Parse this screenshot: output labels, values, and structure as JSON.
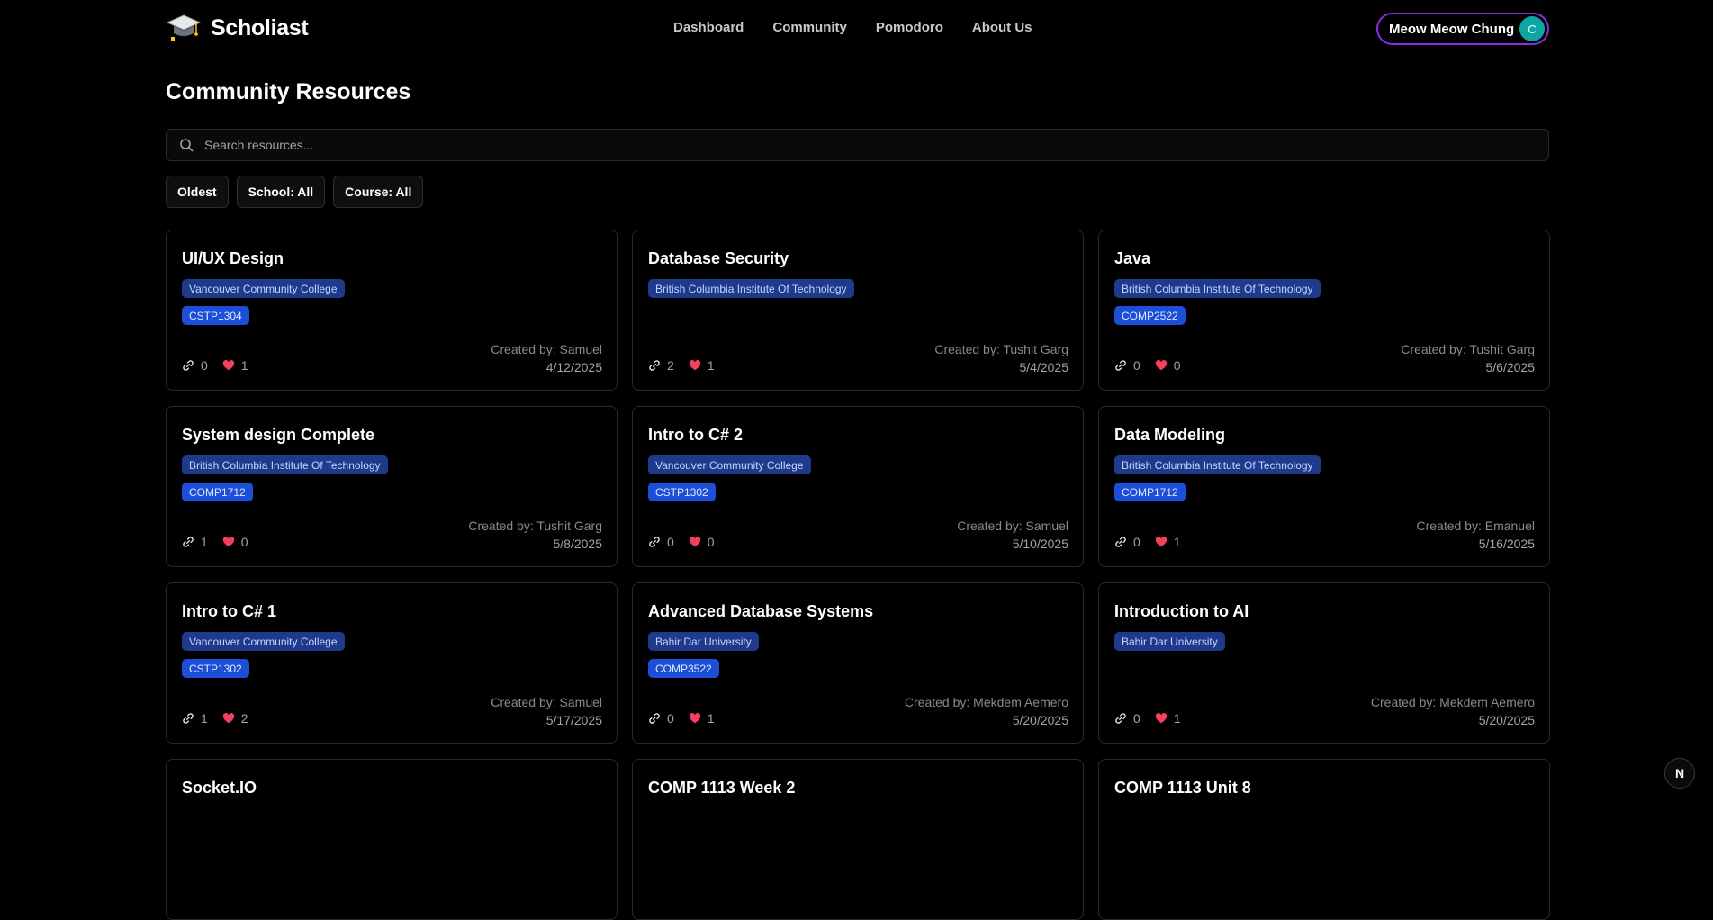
{
  "app": {
    "name": "Scholiast",
    "nav": [
      "Dashboard",
      "Community",
      "Pomodoro",
      "About Us"
    ],
    "user": {
      "name": "Meow Meow Chung",
      "initial": "C"
    }
  },
  "page": {
    "title": "Community Resources",
    "search_placeholder": "Search resources...",
    "filters": [
      "Oldest",
      "School: All",
      "Course: All"
    ]
  },
  "resources": [
    {
      "title": "UI/UX Design",
      "school": "Vancouver Community College",
      "course": "CSTP1304",
      "links": "0",
      "likes": "1",
      "author": "Created by: Samuel",
      "date": "4/12/2025"
    },
    {
      "title": "Database Security",
      "school": "British Columbia Institute Of Technology",
      "course": "",
      "links": "2",
      "likes": "1",
      "author": "Created by: Tushit Garg",
      "date": "5/4/2025"
    },
    {
      "title": "Java",
      "school": "British Columbia Institute Of Technology",
      "course": "COMP2522",
      "links": "0",
      "likes": "0",
      "author": "Created by: Tushit Garg",
      "date": "5/6/2025"
    },
    {
      "title": "System design Complete",
      "school": "British Columbia Institute Of Technology",
      "course": "COMP1712",
      "links": "1",
      "likes": "0",
      "author": "Created by: Tushit Garg",
      "date": "5/8/2025"
    },
    {
      "title": "Intro to C# 2",
      "school": "Vancouver Community College",
      "course": "CSTP1302",
      "links": "0",
      "likes": "0",
      "author": "Created by: Samuel",
      "date": "5/10/2025"
    },
    {
      "title": "Data Modeling",
      "school": "British Columbia Institute Of Technology",
      "course": "COMP1712",
      "links": "0",
      "likes": "1",
      "author": "Created by: Emanuel",
      "date": "5/16/2025"
    },
    {
      "title": "Intro to C# 1",
      "school": "Vancouver Community College",
      "course": "CSTP1302",
      "links": "1",
      "likes": "2",
      "author": "Created by: Samuel",
      "date": "5/17/2025"
    },
    {
      "title": "Advanced Database Systems",
      "school": "Bahir Dar University",
      "course": "COMP3522",
      "links": "0",
      "likes": "1",
      "author": "Created by: Mekdem Aemero",
      "date": "5/20/2025"
    },
    {
      "title": "Introduction to AI",
      "school": "Bahir Dar University",
      "course": "",
      "links": "0",
      "likes": "1",
      "author": "Created by: Mekdem Aemero",
      "date": "5/20/2025"
    },
    {
      "title": "Socket.IO",
      "school": "",
      "course": "",
      "links": "",
      "likes": "",
      "author": "",
      "date": ""
    },
    {
      "title": "COMP 1113 Week 2",
      "school": "",
      "course": "",
      "links": "",
      "likes": "",
      "author": "",
      "date": ""
    },
    {
      "title": "COMP 1113 Unit 8",
      "school": "",
      "course": "",
      "links": "",
      "likes": "",
      "author": "",
      "date": ""
    }
  ],
  "devtools": {
    "label": "N"
  },
  "colors": {
    "background": "#000000",
    "accent_border": "#8b2be2",
    "avatar": "#0ea5a4",
    "school_badge": "#1e3a8a",
    "course_badge": "#1d4ed8",
    "heart": "#f43f5e"
  },
  "icons": [
    "graduation-cap-logo-icon",
    "search-icon",
    "link-icon",
    "heart-icon",
    "next-devtools-icon"
  ]
}
